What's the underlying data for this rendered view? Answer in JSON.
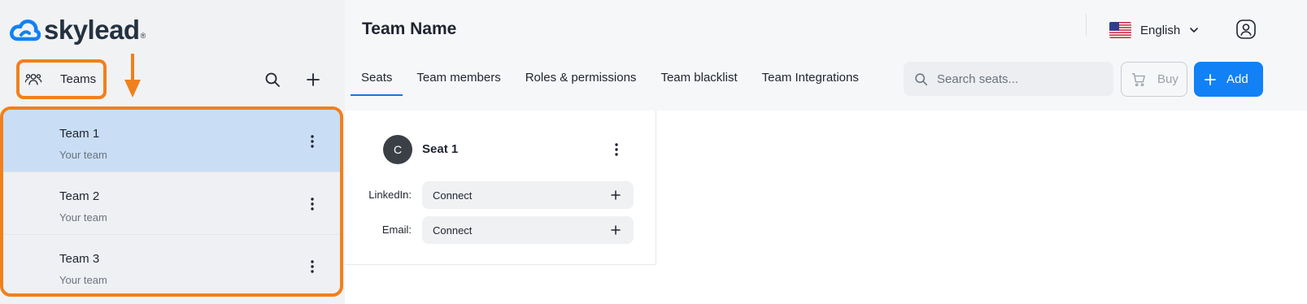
{
  "brand": {
    "name": "skylead",
    "registered": "®",
    "color": "#1181f5"
  },
  "sidebar": {
    "header_label": "Teams",
    "icons": {
      "header": "team-group-icon",
      "search": "search-icon",
      "add": "plus-icon"
    },
    "teams": [
      {
        "name": "Team 1",
        "subtitle": "Your team",
        "selected": true
      },
      {
        "name": "Team 2",
        "subtitle": "Your team",
        "selected": false
      },
      {
        "name": "Team 3",
        "subtitle": "Your team",
        "selected": false
      }
    ]
  },
  "header": {
    "title": "Team Name",
    "language": {
      "label": "English",
      "flag": "us-flag-icon"
    },
    "user_icon": "user-account-icon"
  },
  "tabs": [
    {
      "label": "Seats",
      "active": true
    },
    {
      "label": "Team members",
      "active": false
    },
    {
      "label": "Roles & permissions",
      "active": false
    },
    {
      "label": "Team blacklist",
      "active": false
    },
    {
      "label": "Team Integrations",
      "active": false
    }
  ],
  "search": {
    "placeholder": "Search seats...",
    "value": ""
  },
  "actions": {
    "buy_label": "Buy",
    "add_label": "Add"
  },
  "seat": {
    "avatar_initial": "C",
    "title": "Seat 1",
    "connections": [
      {
        "label": "LinkedIn:",
        "value": "Connect"
      },
      {
        "label": "Email:",
        "value": "Connect"
      }
    ]
  },
  "colors": {
    "accent": "#1181f5",
    "annotation": "#f0801d",
    "selected_row": "#c9def4"
  }
}
